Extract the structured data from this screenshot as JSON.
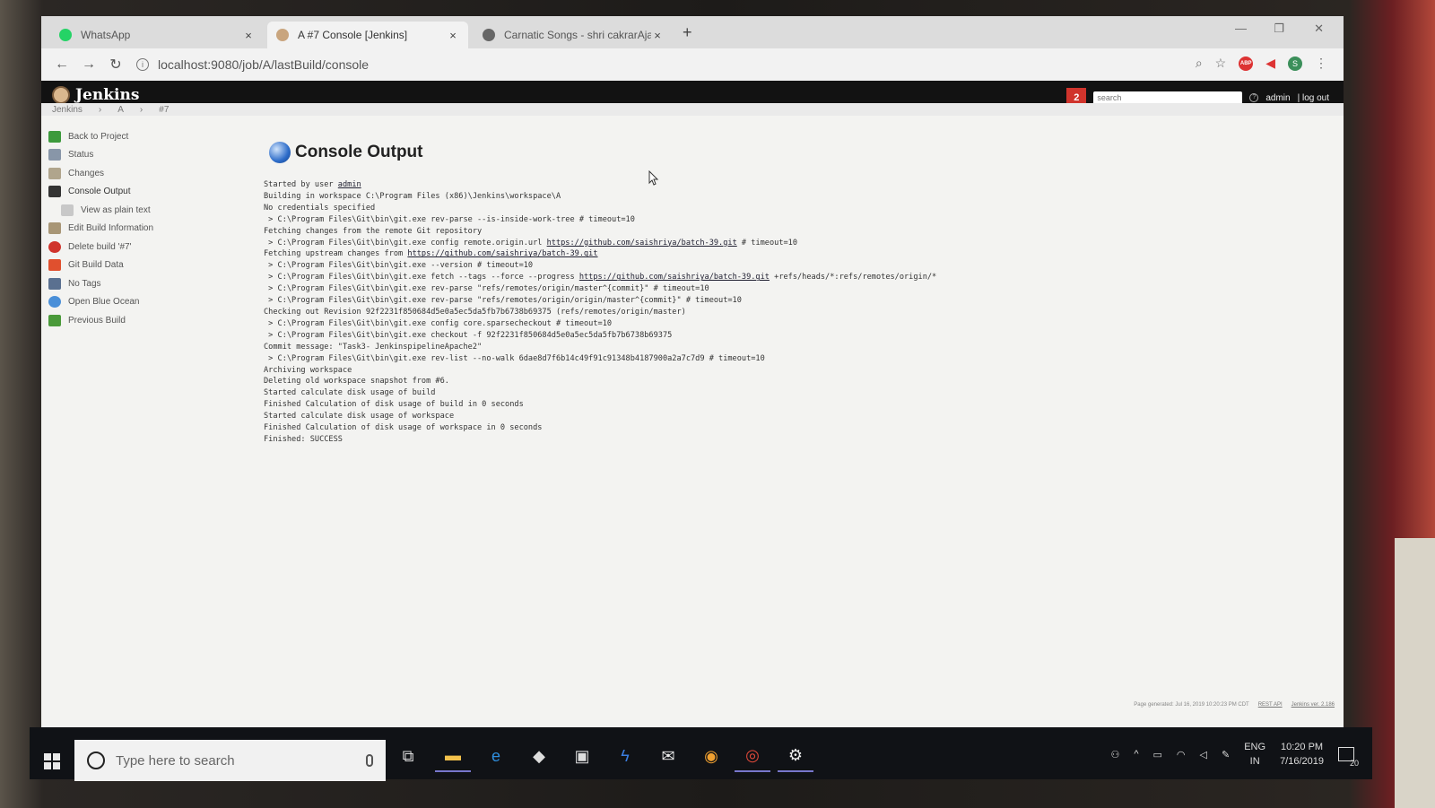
{
  "browser": {
    "tabs": [
      {
        "label": "WhatsApp",
        "favicon_color": "#25d366",
        "active": false
      },
      {
        "label": "A #7 Console [Jenkins]",
        "favicon_color": "#c9a57e",
        "active": true
      },
      {
        "label": "Carnatic Songs - shri cakrarAja si",
        "favicon_color": "#666666",
        "active": false
      }
    ],
    "close_glyph": "×",
    "new_tab_glyph": "+",
    "window_controls": [
      "—",
      "❐",
      "✕"
    ],
    "url": "localhost:9080/job/A/lastBuild/console",
    "nav": {
      "back": "←",
      "forward": "→",
      "reload": "↻"
    },
    "extensions": {
      "abp_label": "ABP",
      "profile_initial": "S"
    }
  },
  "jenkins": {
    "logo_text": "Jenkins",
    "notification_count": "2",
    "search_placeholder": "search",
    "user": "admin",
    "logout": "| log out",
    "breadcrumbs": [
      "Jenkins",
      "›",
      "A",
      "›",
      "#7"
    ],
    "side_panel": [
      {
        "label": "Back to Project",
        "icon": "up-arrow-icon",
        "color": "#3c9a3c",
        "sub": false
      },
      {
        "label": "Status",
        "icon": "magnifier-icon",
        "color": "#8896a8",
        "sub": false
      },
      {
        "label": "Changes",
        "icon": "notepad-icon",
        "color": "#b0a58c",
        "sub": false
      },
      {
        "label": "Console Output",
        "icon": "terminal-icon",
        "color": "#333333",
        "sub": false
      },
      {
        "label": "View as plain text",
        "icon": "document-icon",
        "color": "#c8c8c8",
        "sub": true
      },
      {
        "label": "Edit Build Information",
        "icon": "notepad-pencil-icon",
        "color": "#a89676",
        "sub": false
      },
      {
        "label": "Delete build '#7'",
        "icon": "no-entry-icon",
        "color": "#d0342c",
        "sub": false
      },
      {
        "label": "Git Build Data",
        "icon": "git-icon",
        "color": "#e0502e",
        "sub": false
      },
      {
        "label": "No Tags",
        "icon": "monitor-icon",
        "color": "#5a7090",
        "sub": false
      },
      {
        "label": "Open Blue Ocean",
        "icon": "blue-ocean-icon",
        "color": "#4a8fd8",
        "sub": false
      },
      {
        "label": "Previous Build",
        "icon": "green-arrow-icon",
        "color": "#4a9a3a",
        "sub": false
      }
    ],
    "console_title": "Console Output",
    "console_lines": [
      {
        "parts": [
          {
            "t": "Started by user "
          },
          {
            "t": "admin",
            "link": true
          }
        ]
      },
      {
        "parts": [
          {
            "t": "Building in workspace C:\\Program Files (x86)\\Jenkins\\workspace\\A"
          }
        ]
      },
      {
        "parts": [
          {
            "t": "No credentials specified"
          }
        ]
      },
      {
        "parts": [
          {
            "t": " > C:\\Program Files\\Git\\bin\\git.exe rev-parse --is-inside-work-tree # timeout=10"
          }
        ]
      },
      {
        "parts": [
          {
            "t": "Fetching changes from the remote Git repository"
          }
        ]
      },
      {
        "parts": [
          {
            "t": " > C:\\Program Files\\Git\\bin\\git.exe config remote.origin.url "
          },
          {
            "t": "https://github.com/saishriya/batch-39.git",
            "link": true
          },
          {
            "t": " # timeout=10"
          }
        ]
      },
      {
        "parts": [
          {
            "t": "Fetching upstream changes from "
          },
          {
            "t": "https://github.com/saishriya/batch-39.git",
            "link": true
          }
        ]
      },
      {
        "parts": [
          {
            "t": " > C:\\Program Files\\Git\\bin\\git.exe --version # timeout=10"
          }
        ]
      },
      {
        "parts": [
          {
            "t": " > C:\\Program Files\\Git\\bin\\git.exe fetch --tags --force --progress "
          },
          {
            "t": "https://github.com/saishriya/batch-39.git",
            "link": true
          },
          {
            "t": " +refs/heads/*:refs/remotes/origin/*"
          }
        ]
      },
      {
        "parts": [
          {
            "t": " > C:\\Program Files\\Git\\bin\\git.exe rev-parse \"refs/remotes/origin/master^{commit}\" # timeout=10"
          }
        ]
      },
      {
        "parts": [
          {
            "t": " > C:\\Program Files\\Git\\bin\\git.exe rev-parse \"refs/remotes/origin/origin/master^{commit}\" # timeout=10"
          }
        ]
      },
      {
        "parts": [
          {
            "t": "Checking out Revision 92f2231f850684d5e0a5ec5da5fb7b6738b69375 (refs/remotes/origin/master)"
          }
        ]
      },
      {
        "parts": [
          {
            "t": " > C:\\Program Files\\Git\\bin\\git.exe config core.sparsecheckout # timeout=10"
          }
        ]
      },
      {
        "parts": [
          {
            "t": " > C:\\Program Files\\Git\\bin\\git.exe checkout -f 92f2231f850684d5e0a5ec5da5fb7b6738b69375"
          }
        ]
      },
      {
        "parts": [
          {
            "t": "Commit message: \"Task3- JenkinspipelineApache2\""
          }
        ]
      },
      {
        "parts": [
          {
            "t": " > C:\\Program Files\\Git\\bin\\git.exe rev-list --no-walk 6dae8d7f6b14c49f91c91348b4187900a2a7c7d9 # timeout=10"
          }
        ]
      },
      {
        "parts": [
          {
            "t": "Archiving workspace"
          }
        ]
      },
      {
        "parts": [
          {
            "t": "Deleting old workspace snapshot from #6."
          }
        ]
      },
      {
        "parts": [
          {
            "t": "Started calculate disk usage of build"
          }
        ]
      },
      {
        "parts": [
          {
            "t": "Finished Calculation of disk usage of build in 0 seconds"
          }
        ]
      },
      {
        "parts": [
          {
            "t": "Started calculate disk usage of workspace"
          }
        ]
      },
      {
        "parts": [
          {
            "t": "Finished Calculation of disk usage of workspace in 0 seconds"
          }
        ]
      },
      {
        "parts": [
          {
            "t": "Finished: SUCCESS"
          }
        ]
      }
    ],
    "footer": {
      "generated": "Page generated: Jul 16, 2019 10:20:23 PM CDT",
      "rest_api": "REST API",
      "version": "Jenkins ver. 2.186"
    }
  },
  "taskbar": {
    "search_placeholder": "Type here to search",
    "apps": [
      {
        "name": "task-view-icon",
        "glyph": "⧉",
        "color": "#dddddd"
      },
      {
        "name": "file-explorer-icon",
        "glyph": "▬",
        "color": "#f3c14b",
        "active": true
      },
      {
        "name": "edge-icon",
        "glyph": "e",
        "color": "#2f8fdf"
      },
      {
        "name": "dropbox-icon",
        "glyph": "◆",
        "color": "#dddddd"
      },
      {
        "name": "store-icon",
        "glyph": "▣",
        "color": "#dddddd"
      },
      {
        "name": "lightning-app-icon",
        "glyph": "ϟ",
        "color": "#3a7de0"
      },
      {
        "name": "mail-icon",
        "glyph": "✉",
        "color": "#eeeeee"
      },
      {
        "name": "vpn-app-icon",
        "glyph": "◉",
        "color": "#f0a030"
      },
      {
        "name": "chrome-icon",
        "glyph": "◎",
        "color": "#e44a3a",
        "active": true
      },
      {
        "name": "settings-gear-icon",
        "glyph": "⚙",
        "color": "#eeeeee",
        "active": true
      }
    ],
    "tray": {
      "lang_top": "ENG",
      "lang_bottom": "IN",
      "time": "10:20 PM",
      "date": "7/16/2019",
      "notifications": "20"
    }
  }
}
